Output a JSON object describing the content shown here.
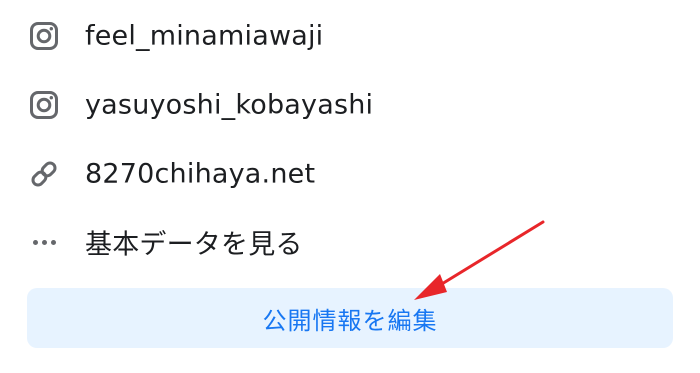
{
  "profile_links": {
    "instagram_1": {
      "label": "feel_minamiawaji",
      "icon": "instagram-icon"
    },
    "instagram_2": {
      "label": "yasuyoshi_kobayashi",
      "icon": "instagram-icon"
    },
    "website": {
      "label": "8270chihaya.net",
      "icon": "link-icon"
    },
    "more": {
      "label": "基本データを見る",
      "icon": "more-dots-icon"
    }
  },
  "edit_button": {
    "label": "公開情報を編集"
  },
  "colors": {
    "icon_gray": "#65676b",
    "text": "#1c1e21",
    "button_bg": "#e7f3ff",
    "button_text": "#1877f2",
    "arrow": "#e8262a"
  }
}
